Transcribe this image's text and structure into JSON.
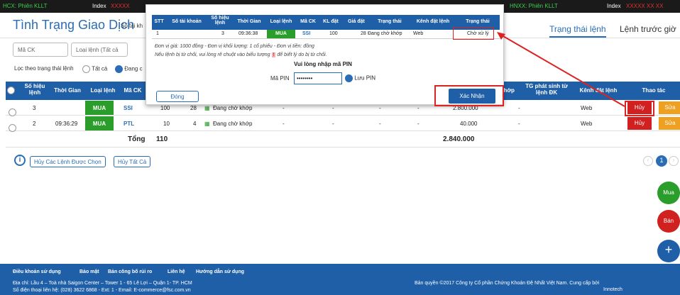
{
  "topbar": {
    "left_text": "HCX: Phiên KLLT",
    "index_label": "Index",
    "index_value": "XXXXX",
    "right_text": "HNXX: Phiên KLLT",
    "index_label2": "Index",
    "index_value2": "XXXXX XX XX"
  },
  "header": {
    "title": "Tình Trạng Giao Dịch",
    "account_label": "Số tài kh",
    "tab_status": "Trạng thái lệnh",
    "tab_prev": "Lệnh trước giờ"
  },
  "filters": {
    "symbol_placeholder": "Mã CK",
    "order_type": "Loại lệnh (Tất cả",
    "status_label": "Lọc theo trạng thái lệnh",
    "all": "Tất cả",
    "pending": "Đang c"
  },
  "table": {
    "headers": [
      "Số hiệu lệnh",
      "Thời Gian",
      "Loại lệnh",
      "Mã CK",
      "KL đặt",
      "Giá đặt",
      "Trạng thái",
      "",
      "",
      "",
      "",
      "",
      "khớp",
      "TG phát sinh từ lệnh ĐK",
      "Kênh đặt lệnh",
      "Thao tác"
    ],
    "rows": [
      {
        "no": "3",
        "time": "",
        "type": "MUA",
        "symbol": "SSI",
        "qty": "100",
        "price": "28",
        "status": "Đang chờ khớp",
        "c1": "-",
        "c2": "-",
        "c3": "-",
        "c4": "-",
        "value": "2.800.000",
        "c5": "-",
        "channel": "Web",
        "cancel": "Hủy",
        "edit": "Sửa"
      },
      {
        "no": "2",
        "time": "09:36:29",
        "type": "MUA",
        "symbol": "PTL",
        "qty": "10",
        "price": "4",
        "status": "Đang chờ khớp",
        "c1": "-",
        "c2": "-",
        "c3": "-",
        "c4": "-",
        "value": "40.000",
        "c5": "-",
        "channel": "Web",
        "cancel": "Hủy",
        "edit": "Sửa"
      }
    ],
    "total_label": "Tổng",
    "total_qty": "110",
    "total_value": "2.840.000"
  },
  "actions": {
    "cancel_selected": "Hủy Các Lệnh Được Chọn",
    "cancel_all": "Hủy Tất Cả",
    "page": "1"
  },
  "fab": {
    "buy": "Mua",
    "sell": "Bán",
    "plus": "+"
  },
  "footer": {
    "links": [
      "Điều khoản sử dụng",
      "Bảo mật",
      "Bản công bố rủi ro",
      "Liên hệ",
      "Hướng dẫn sử dụng"
    ],
    "address": "Địa chỉ: Lầu 4 – Toà nhà Saigon Center – Tower 1 - 65 Lê Lợi – Quận 1- TP. HCM",
    "phone": "Số điện thoại liên hệ: (028) 3622 6868 - Ext: 1 - Email: E-commerce@fsc.com.vn",
    "copyright": "Bản quyền ©2017 Công ty Cổ phần Chứng Khoán Đệ Nhất Việt Nam. Cung cấp bởi",
    "provider": "Innotech"
  },
  "modal": {
    "headers": [
      "STT",
      "Số tài khoản",
      "Số hiệu lệnh",
      "Thời Gian",
      "Loại lệnh",
      "Mã CK",
      "KL đặt",
      "Giá đặt",
      "Trạng thái",
      "Kênh đặt lệnh",
      "Trạng thái"
    ],
    "row": {
      "stt": "1",
      "account": "",
      "no": "3",
      "time": "09:36:38",
      "type": "MUA",
      "symbol": "SSI",
      "qty": "100",
      "price": "28",
      "status": "Đang chờ khớp",
      "channel": "Web",
      "state": "Chờ xử lý"
    },
    "note1": "Đơn vị giá: 1000 đồng - Đơn vị khối lượng: 1 cổ phiếu - Đơn vị tiền: đồng",
    "note2": "Nếu lệnh bị từ chối, vui lòng rê chuột vào biểu tượng",
    "note3": "để biết lý do bị từ chối.",
    "pin_prompt": "Vui lòng nhập mã PIN",
    "pin_label": "Mã PIN",
    "pin_value": "••••••••",
    "save_pin": "Lưu PIN",
    "close": "Đóng",
    "confirm": "Xác Nhận"
  }
}
